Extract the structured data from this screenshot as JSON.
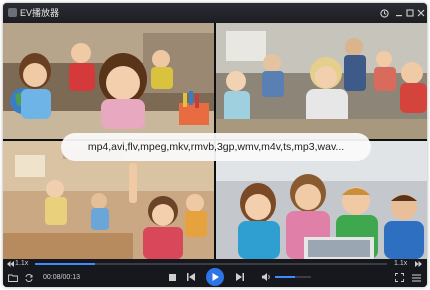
{
  "app": {
    "title": "EV播放器",
    "icons": {
      "logo": "app-logo-icon",
      "history": "history-icon",
      "minimize": "minimize-icon",
      "maximize": "maximize-icon",
      "close": "close-icon"
    }
  },
  "overlay": {
    "text": "mp4,avi,flv,mpeg,mkv,rmvb,3gp,wmv,m4v,ts,mp3,wav..."
  },
  "controls": {
    "speed_down_label": "1.1x",
    "speed_up_label": "1.1x",
    "timecode": "00:08/00:13",
    "progress_fraction": 0.17,
    "volume_fraction": 0.55,
    "icons": {
      "folder": "folder-icon",
      "loop": "loop-icon",
      "stop": "stop-icon",
      "previous": "previous-icon",
      "play": "play-icon",
      "next": "next-icon",
      "volume": "volume-icon",
      "fullscreen": "fullscreen-icon",
      "playlist": "playlist-icon"
    }
  },
  "colors": {
    "accent": "#2c74e8",
    "window_bg": "#15171c",
    "overlay_bg": "#fafafa"
  }
}
